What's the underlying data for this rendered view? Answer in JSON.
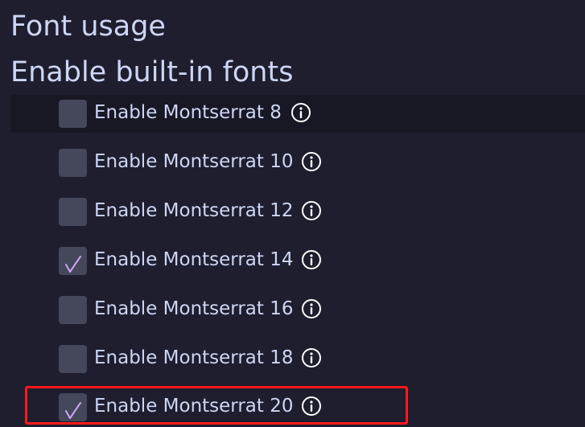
{
  "section_title": "Font usage",
  "subsection_title": "Enable built-in fonts",
  "options": [
    {
      "label": "Enable Montserrat 8",
      "checked": false
    },
    {
      "label": "Enable Montserrat 10",
      "checked": false
    },
    {
      "label": "Enable Montserrat 12",
      "checked": false
    },
    {
      "label": "Enable Montserrat 14",
      "checked": true
    },
    {
      "label": "Enable Montserrat 16",
      "checked": false
    },
    {
      "label": "Enable Montserrat 18",
      "checked": false
    },
    {
      "label": "Enable Montserrat 20",
      "checked": true
    }
  ],
  "colors": {
    "background": "#1e1e2e",
    "row_highlight": "#181825",
    "text": "#cdd6f4",
    "checkbox": "#45475a",
    "check_mark": "#cba6f7",
    "annotation_box": "#ff1a1a"
  },
  "icons": {
    "info": "info-circle-icon",
    "check": "check-icon"
  }
}
